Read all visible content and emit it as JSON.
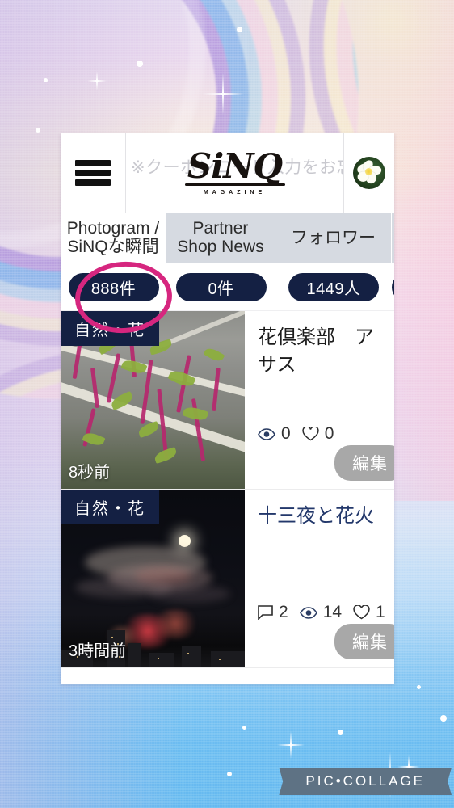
{
  "background": {
    "style_name": "pastel-rainbow-collage",
    "top_color": "#e4d9ef",
    "bottom_color": "#6dbdf1",
    "accent_pink": "#f6c8de"
  },
  "annotation": {
    "name": "pink-circle-highlight",
    "color": "#d6267f",
    "targets": "888件"
  },
  "app": {
    "header": {
      "menu_icon": "hamburger-menu-icon",
      "coupon_note": "※クーポンコード入力をお忘れな",
      "logo_mark": "SiNQ",
      "logo_subtitle": "MAGAZINE",
      "avatar_icon": "plumeria-flower-avatar"
    },
    "tabs": [
      {
        "label": "Photogram /\nSiNQな瞬間",
        "line1": "Photogram /",
        "line2": "SiNQな瞬間",
        "active": true,
        "count": "888件"
      },
      {
        "label": "Partner\nShop News",
        "line1": "Partner",
        "line2": "Shop News",
        "active": false,
        "count": "0件"
      },
      {
        "label": "フォロワー",
        "line1": "フォロワー",
        "line2": "",
        "active": false,
        "count": "1449人"
      },
      {
        "label": "",
        "line1": "",
        "line2": "",
        "active": false,
        "count": ""
      }
    ],
    "cards": [
      {
        "category": "自然・花",
        "timestamp": "8秒前",
        "title_line1": "花倶楽部　ア",
        "title_line2": "サス",
        "title_color": "dark",
        "metrics": [
          {
            "icon": "eye-icon",
            "value": "0"
          },
          {
            "icon": "heart-icon",
            "value": "0"
          }
        ],
        "edit_label": "編集"
      },
      {
        "category": "自然・花",
        "timestamp": "3時間前",
        "title_line1": "十三夜と花火",
        "title_line2": "",
        "title_color": "navy",
        "metrics": [
          {
            "icon": "comment-icon",
            "value": "2"
          },
          {
            "icon": "eye-icon",
            "value": "14"
          },
          {
            "icon": "heart-icon",
            "value": "1"
          }
        ],
        "edit_label": "編集"
      }
    ]
  },
  "watermark": {
    "text": "PIC•COLLAGE"
  }
}
